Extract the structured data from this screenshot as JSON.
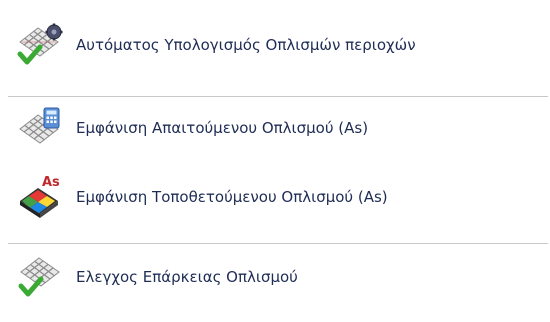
{
  "menu": {
    "items": [
      {
        "label": "Αυτόματος Υπολογισμός Οπλισμών περιοχών",
        "icon": "rebar-grid-gear-check-icon"
      },
      {
        "label": "Εμφάνιση Απαιτούμενου Οπλισμού (As)",
        "icon": "rebar-grid-calculator-icon"
      },
      {
        "label": "Εμφάνιση Τοποθετούμενου Οπλισμού (As)",
        "icon": "colored-slab-as-icon",
        "badge": "As"
      },
      {
        "label": "Ελεγχος Επάρκειας Οπλισμού",
        "icon": "rebar-grid-check-icon"
      }
    ]
  },
  "colors": {
    "text": "#1f2d55",
    "divider": "#c8c8c8",
    "check": "#3aaa35",
    "rebar": "#8a8a8a",
    "badge": "#c0282d"
  }
}
